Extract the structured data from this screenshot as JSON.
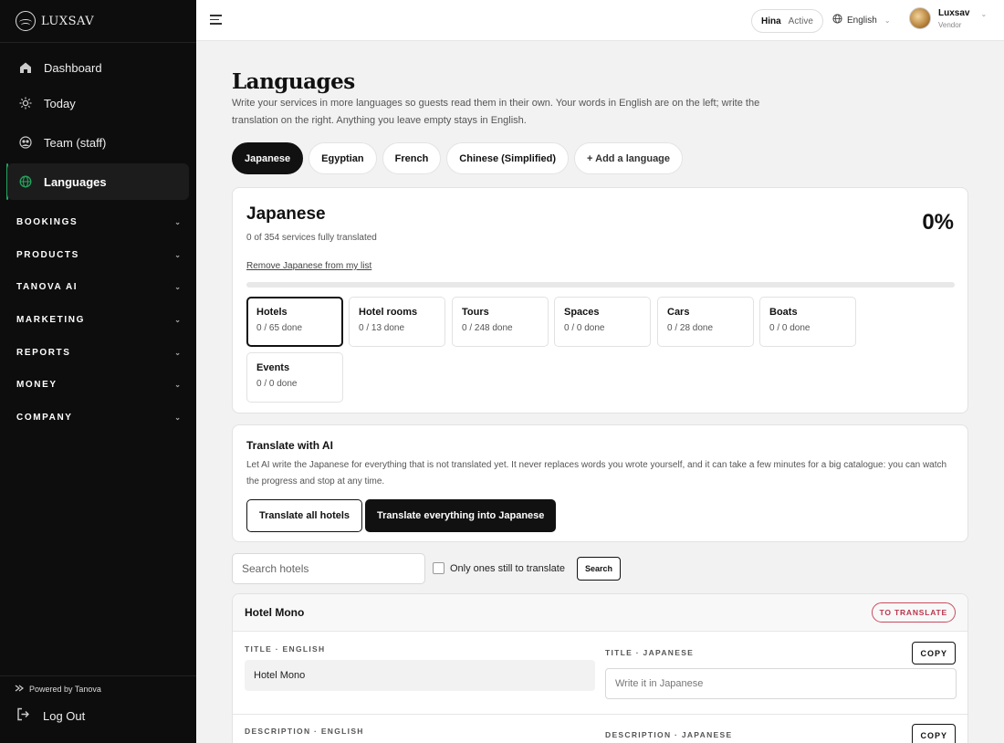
{
  "brand": {
    "name": "LUXSAV"
  },
  "sidebar": {
    "items": [
      {
        "label": "Dashboard",
        "icon": "home-icon"
      },
      {
        "label": "Today",
        "icon": "sun-icon"
      },
      {
        "label": "Team (staff)",
        "icon": "team-icon"
      },
      {
        "label": "Languages",
        "icon": "globe-icon"
      }
    ],
    "sections": [
      "BOOKINGS",
      "PRODUCTS",
      "TANOVA AI",
      "MARKETING",
      "REPORTS",
      "MONEY",
      "COMPANY"
    ],
    "powered_by": "Powered by Tanova",
    "logout": "Log Out",
    "accent_color": "#22a45d"
  },
  "topbar": {
    "status_name": "Hina",
    "status_state": "Active",
    "language": "English",
    "user_name": "Luxsav",
    "user_role": "Vendor"
  },
  "page": {
    "title": "Languages",
    "description": "Write your services in more languages so guests read them in their own. Your words in English are on the left; write the translation on the right. Anything you leave empty stays in English."
  },
  "tabs": [
    "Japanese",
    "Egyptian",
    "French",
    "Chinese (Simplified)"
  ],
  "add_language": "+ Add a language",
  "language_card": {
    "name": "Japanese",
    "subtitle": "0 of 354 services fully translated",
    "percent": "0%",
    "progress": 0,
    "remove_link": "Remove Japanese from my list",
    "categories": [
      {
        "name": "Hotels",
        "done": "0 / 65 done"
      },
      {
        "name": "Hotel rooms",
        "done": "0 / 13 done"
      },
      {
        "name": "Tours",
        "done": "0 / 248 done"
      },
      {
        "name": "Spaces",
        "done": "0 / 0 done"
      },
      {
        "name": "Cars",
        "done": "0 / 28 done"
      },
      {
        "name": "Boats",
        "done": "0 / 0 done"
      },
      {
        "name": "Events",
        "done": "0 / 0 done"
      }
    ]
  },
  "ai": {
    "title": "Translate with AI",
    "description": "Let AI write the Japanese for everything that is not translated yet. It never replaces words you wrote yourself, and it can take a few minutes for a big catalogue: you can watch the progress and stop at any time.",
    "btn_hotels": "Translate all hotels",
    "btn_all": "Translate everything into Japanese"
  },
  "filter": {
    "search_placeholder": "Search hotels",
    "only_label": "Only ones still to translate",
    "search_button": "Search"
  },
  "hotel": {
    "name": "Hotel Mono",
    "badge": "TO TRANSLATE",
    "title_en_label": "TITLE · ENGLISH",
    "title_en_value": "Hotel Mono",
    "title_ja_label": "TITLE · JAPANESE",
    "title_ja_placeholder": "Write it in Japanese",
    "copy_label": "COPY",
    "desc_en_label": "DESCRIPTION · ENGLISH",
    "desc_ja_label": "DESCRIPTION · JAPANESE"
  }
}
